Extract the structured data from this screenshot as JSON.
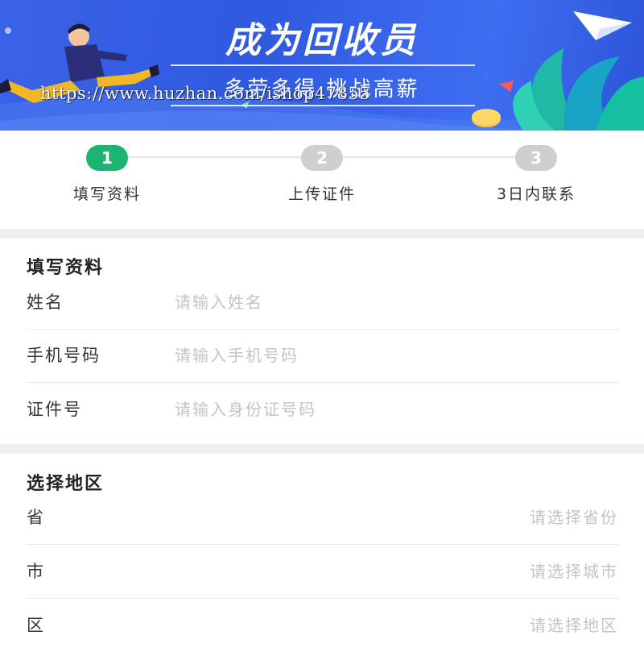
{
  "banner": {
    "title": "成为回收员",
    "subtitle": "多劳多得 挑战高薪",
    "watermark": "https://www.huzhan.com/ishop47855"
  },
  "steps": [
    {
      "number": "1",
      "label": "填写资料",
      "active": true
    },
    {
      "number": "2",
      "label": "上传证件",
      "active": false
    },
    {
      "number": "3",
      "label": "3日内联系",
      "active": false
    }
  ],
  "info_section": {
    "title": "填写资料",
    "fields": [
      {
        "label": "姓名",
        "placeholder": "请输入姓名",
        "value": ""
      },
      {
        "label": "手机号码",
        "placeholder": "请输入手机号码",
        "value": ""
      },
      {
        "label": "证件号",
        "placeholder": "请输入身份证号码",
        "value": ""
      }
    ]
  },
  "region_section": {
    "title": "选择地区",
    "fields": [
      {
        "label": "省",
        "placeholder": "请选择省份"
      },
      {
        "label": "市",
        "placeholder": "请选择城市"
      },
      {
        "label": "区",
        "placeholder": "请选择地区"
      }
    ]
  },
  "colors": {
    "accent_green": "#1bb473",
    "inactive_step": "#cfcfcf",
    "banner_blue": "#3a62e6",
    "placeholder": "#c4c4c4"
  }
}
